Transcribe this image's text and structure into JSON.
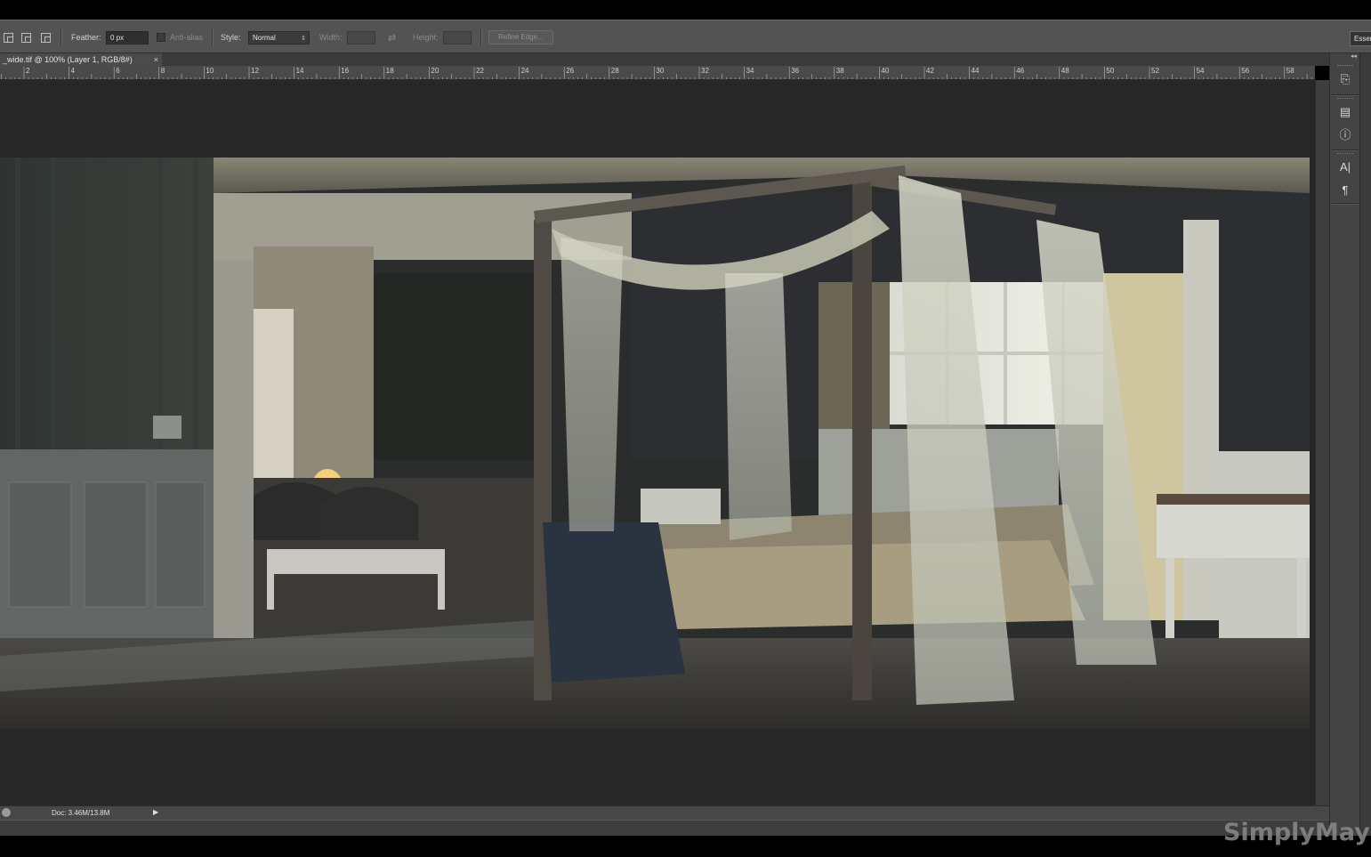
{
  "options_bar": {
    "feather_label": "Feather:",
    "feather_value": "0 px",
    "antialias_label": "Anti-alias",
    "style_label": "Style:",
    "style_value": "Normal",
    "width_label": "Width:",
    "height_label": "Height:",
    "refine_edges_label": "Refine Edge...",
    "workspace_label": "Essentials"
  },
  "document_tab": {
    "title": "_wide.tif @ 100% (Layer 1, RGB/8#)",
    "close": "×"
  },
  "ruler": {
    "labels": [
      "2",
      "4",
      "6",
      "8",
      "10",
      "12",
      "14",
      "16",
      "18",
      "20",
      "22",
      "24",
      "26",
      "28",
      "30",
      "32",
      "34",
      "36",
      "38",
      "40",
      "42",
      "44",
      "46",
      "48",
      "50",
      "52",
      "54",
      "56",
      "58"
    ]
  },
  "status_bar": {
    "doc_info": "Doc: 3.46M/13.8M",
    "arrow": "▶"
  },
  "panels": {
    "icons": [
      "history-icon",
      "properties-icon",
      "info-icon",
      "character-icon",
      "paragraph-icon"
    ],
    "glyphs": [
      "⎘",
      "▤",
      "ⓘ",
      "A|",
      "¶"
    ]
  },
  "watermark": "SimplyMaya"
}
